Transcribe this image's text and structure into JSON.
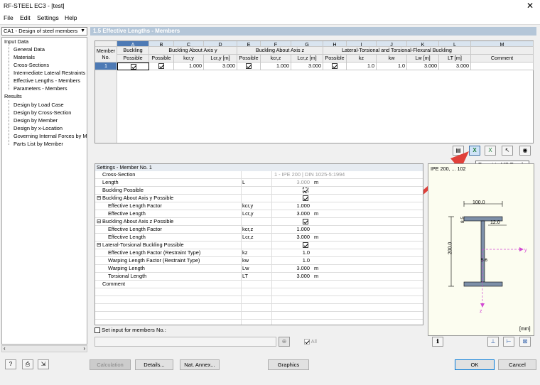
{
  "window": {
    "title": "RF-STEEL EC3 - [test]",
    "close_glyph": "✕"
  },
  "menu": {
    "file": "File",
    "edit": "Edit",
    "settings": "Settings",
    "help": "Help"
  },
  "case_selector": {
    "value": "CA1 - Design of steel members"
  },
  "tree": {
    "input_data": "Input Data",
    "input_items": [
      "General Data",
      "Materials",
      "Cross-Sections",
      "Intermediate Lateral Restraints",
      "Effective Lengths - Members",
      "Parameters - Members"
    ],
    "results": "Results",
    "result_items": [
      "Design by Load Case",
      "Design by Cross-Section",
      "Design by Member",
      "Design by x-Location",
      "Governing Internal Forces by M",
      "Parts List by Member"
    ]
  },
  "section_title": "1.5 Effective Lengths - Members",
  "table": {
    "col_letters": [
      "A",
      "B",
      "C",
      "D",
      "E",
      "F",
      "G",
      "H",
      "I",
      "J",
      "K",
      "L",
      "M"
    ],
    "member_no_header": [
      "Member",
      "No."
    ],
    "group_headers": {
      "buckling": "Buckling",
      "axis_y": "Buckling About Axis y",
      "axis_z": "Buckling About Axis z",
      "lt": "Lateral-Torsional and Torsional-Flexural Buckling"
    },
    "sub_headers": [
      "Possible",
      "Possible",
      "kcr,y",
      "Lcr,y [m]",
      "Possible",
      "kcr,z",
      "Lcr,z [m]",
      "Possible",
      "kz",
      "kw",
      "Lw [m]",
      "LT [m]",
      "Comment"
    ],
    "row": {
      "no": "1",
      "kcry": "1.000",
      "lcry": "3.000",
      "kcrz": "1.000",
      "lcrz": "3.000",
      "kz": "1.0",
      "kw": "1.0",
      "lw": "3.000",
      "lt": "3.000"
    }
  },
  "tooltip": "Export to MS Excel",
  "settings": {
    "title": "Settings - Member No. 1",
    "cross_section_label": "Cross-Section",
    "cross_section_value": "1 - IPE 200 | DIN 1025-5:1994",
    "length_label": "Length",
    "length_sym": "L",
    "length_value": "3.000",
    "length_unit": "m",
    "buckling_possible": "Buckling Possible",
    "axis_y_possible": "Buckling About Axis y Possible",
    "eff_len_factor": "Effective Length Factor",
    "eff_len": "Effective Length",
    "kcry_sym": "kcr,y",
    "kcry_val": "1.000",
    "lcry_sym": "Lcr,y",
    "lcry_val": "3.000",
    "axis_z_possible": "Buckling About Axis z Possible",
    "kcrz_sym": "kcr,z",
    "kcrz_val": "1.000",
    "lcrz_sym": "Lcr,z",
    "lcrz_val": "3.000",
    "lt_possible": "Lateral-Torsional Buckling Possible",
    "eff_len_factor_rt": "Effective Length Factor (Restraint Type)",
    "kz_sym": "kz",
    "kz_val": "1.0",
    "warp_factor": "Warping Length Factor (Restraint Type)",
    "kw_sym": "kw",
    "kw_val": "1.0",
    "warp_len": "Warping Length",
    "lw_sym": "Lw",
    "lw_val": "3.000",
    "tors_len": "Torsional Length",
    "lt_sym": "LT",
    "lt_val": "3.000",
    "comment": "Comment",
    "unit_m": "m"
  },
  "set_input": "Set input for members No.:",
  "all_label": "All",
  "preview": {
    "title": "IPE 200, ... 102",
    "dim_width": "100.0",
    "dim_height": "200.0",
    "dim_tf": "8.5",
    "dim_r": "12.0",
    "dim_tw": "5.6",
    "axis_y": "y",
    "axis_z": "z",
    "unit": "[mm]"
  },
  "buttons": {
    "calculation": "Calculation",
    "details": "Details...",
    "nat_annex": "Nat. Annex...",
    "graphics": "Graphics",
    "ok": "OK",
    "cancel": "Cancel"
  },
  "colors": {
    "accent": "#4d7ab5",
    "arrow": "#e0403a",
    "section_title": "#b4c6d8"
  }
}
